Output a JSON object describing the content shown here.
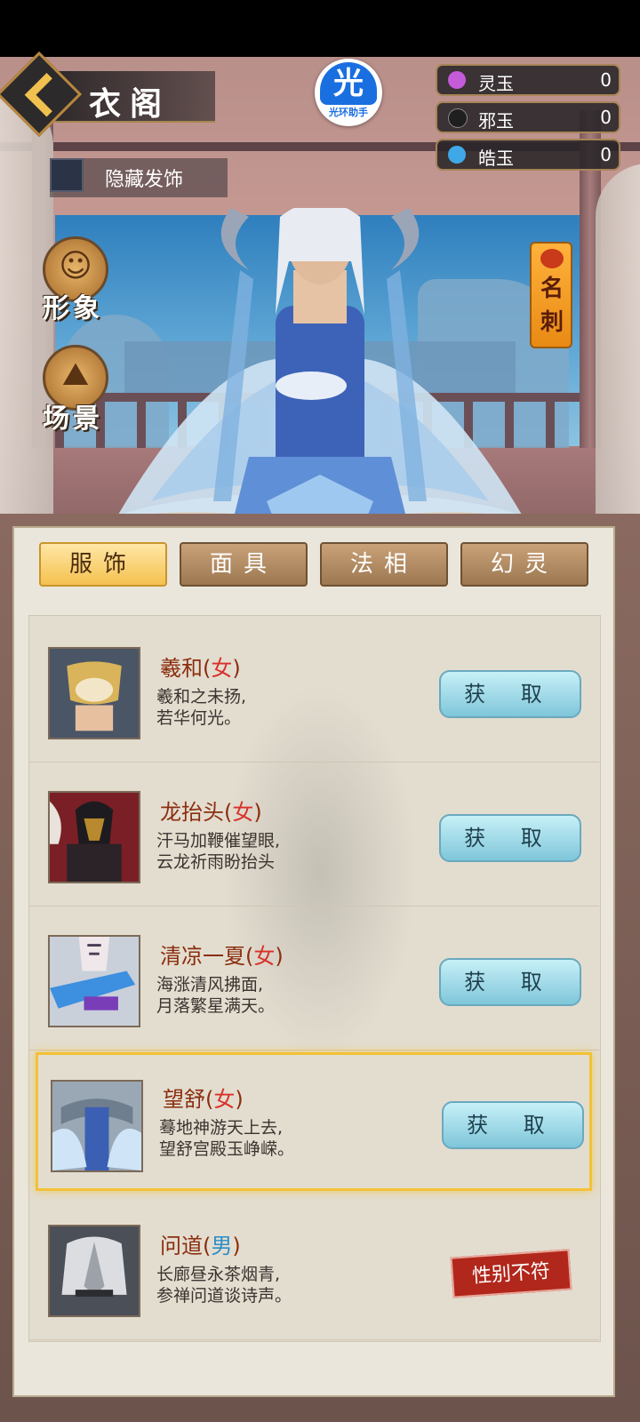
{
  "header": {
    "title": "衣阁",
    "watermark_glyph": "光",
    "watermark_text": "光环助手"
  },
  "currencies": [
    {
      "name": "灵玉",
      "value": "0",
      "color": "#c45bd8"
    },
    {
      "name": "邪玉",
      "value": "0",
      "color": "#1f1f1f"
    },
    {
      "name": "皓玉",
      "value": "0",
      "color": "#3fa9e8"
    }
  ],
  "hide_hair_label": "隐藏发饰",
  "side_menu": {
    "appearance": "形象",
    "scene": "场景"
  },
  "card_button": "名刺",
  "tabs": [
    {
      "label": "服饰",
      "active": true
    },
    {
      "label": "面具",
      "active": false
    },
    {
      "label": "法相",
      "active": false
    },
    {
      "label": "幻灵",
      "active": false
    }
  ],
  "items": [
    {
      "name": "羲和",
      "gender": "女",
      "desc1": "羲和之未扬,",
      "desc2": "若华何光。",
      "action": "获 取",
      "selected": false
    },
    {
      "name": "龙抬头",
      "gender": "女",
      "desc1": "汗马加鞭催望眼,",
      "desc2": "云龙祈雨盼抬头",
      "action": "获 取",
      "selected": false
    },
    {
      "name": "清凉一夏",
      "gender": "女",
      "desc1": "海涨清风拂面,",
      "desc2": "月落繁星满天。",
      "action": "获 取",
      "selected": false
    },
    {
      "name": "望舒",
      "gender": "女",
      "desc1": "蓦地神游天上去,",
      "desc2": "望舒宫殿玉峥嵘。",
      "action": "获 取",
      "selected": true
    },
    {
      "name": "问道",
      "gender": "男",
      "desc1": "长廊昼永茶烟青,",
      "desc2": "参禅问道谈诗声。",
      "action": "性别不符",
      "selected": false
    }
  ]
}
